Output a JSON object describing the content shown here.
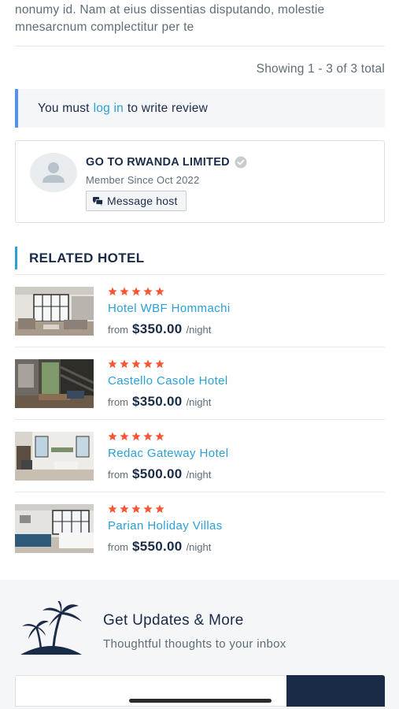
{
  "intro_text": "nonumy id. Nam at eius dissentias disputando, molestie mnesarcnum complectitur per te",
  "reviews": {
    "showing": "Showing 1 - 3 of 3 total",
    "login_prefix": "You must",
    "login_link": "log in",
    "login_suffix": "to write review"
  },
  "host": {
    "name": "GO TO RWANDA LIMITED",
    "member_since": "Member Since Oct 2022",
    "message_label": "Message host"
  },
  "related": {
    "title": "RELATED HOTEL",
    "hotels": [
      {
        "name": "Hotel WBF Hommachi",
        "from": "from",
        "price": "$350.00",
        "per": "/night",
        "rating": 5
      },
      {
        "name": "Castello Casole Hotel",
        "from": "from",
        "price": "$350.00",
        "per": "/night",
        "rating": 5
      },
      {
        "name": "Redac Gateway Hotel",
        "from": "from",
        "price": "$500.00",
        "per": "/night",
        "rating": 5
      },
      {
        "name": "Parian Holiday Villas",
        "from": "from",
        "price": "$550.00",
        "per": "/night",
        "rating": 5
      }
    ]
  },
  "newsletter": {
    "title": "Get Updates & More",
    "subtitle": "Thoughtful thoughts to your inbox"
  },
  "colors": {
    "link": "#2b9fd6",
    "star": "#fa5636",
    "dark": "#1a2b48",
    "muted": "#5e6d77",
    "accent_border": "#5191fa"
  }
}
